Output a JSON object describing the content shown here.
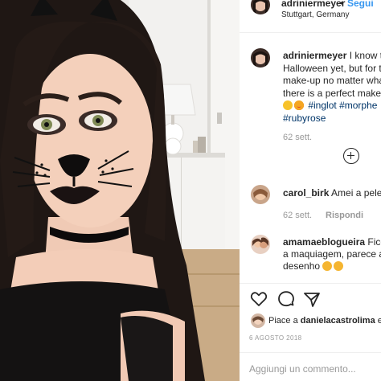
{
  "post": {
    "username": "adriniermeyer",
    "separator": "•",
    "follow_label": "Segui",
    "location": "Stuttgart, Germany"
  },
  "caption": {
    "username": "adriniermeyer",
    "line1": "I know th",
    "line2": "Halloween yet, but for t",
    "line3": "make-up no matter wha",
    "line4": "there is a perfect make-",
    "tags_line5": [
      "#inglot",
      "#morphe"
    ],
    "tags_line6": [
      "#rubyrose"
    ],
    "time": "62 sett."
  },
  "comments": [
    {
      "username": "carol_birk",
      "text": "Amei a pele c",
      "time": "62 sett.",
      "reply_label": "Rispondi"
    },
    {
      "username": "amamaeblogueira",
      "line1": "Ficou",
      "line2": "a maquiagem, parece a",
      "line3": "desenho"
    }
  ],
  "likes": {
    "prefix": "Piace a",
    "username": "danielacastrolima",
    "suffix": "e"
  },
  "date": "6 AGOSTO 2018",
  "add_comment_placeholder": "Aggiungi un commento...",
  "icons": {
    "like": "heart-icon",
    "comment": "comment-icon",
    "share": "share-icon",
    "load_more": "plus-circle-icon",
    "emoji_smile": "smile-emoji",
    "emoji_heart_eyes": "heart-eyes-emoji",
    "emoji_clap": "clap-emoji"
  },
  "colors": {
    "link_blue": "#3897f0",
    "hashtag": "#003569",
    "meta_gray": "#999999",
    "text": "#262626"
  }
}
